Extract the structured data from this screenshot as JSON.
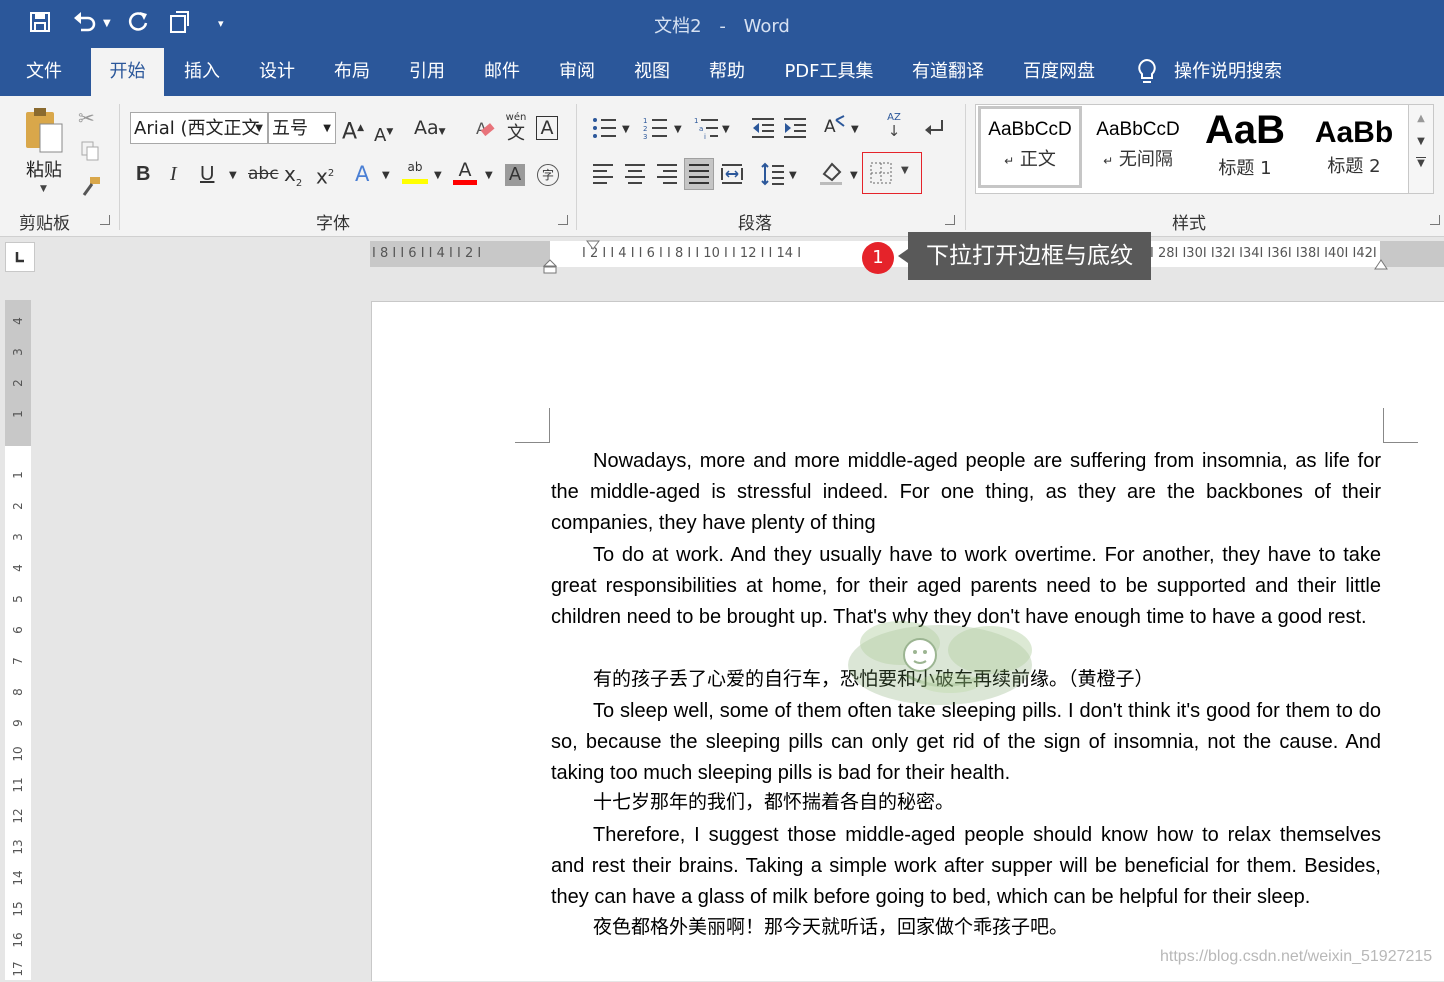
{
  "window": {
    "doc_name": "文档2",
    "dash": "-",
    "app_name": "Word"
  },
  "quick_access": {
    "customize": "▾"
  },
  "menu": {
    "tabs": [
      "文件",
      "开始",
      "插入",
      "设计",
      "布局",
      "引用",
      "邮件",
      "审阅",
      "视图",
      "帮助",
      "PDF工具集",
      "有道翻译",
      "百度网盘"
    ],
    "active_tab": "开始",
    "search": "操作说明搜索"
  },
  "ribbon": {
    "clipboard": {
      "paste": "粘贴",
      "label": "剪贴板"
    },
    "font": {
      "font_name": "Arial (西文正文",
      "font_size": "五号",
      "grow": "A",
      "shrink": "A",
      "change_case": "Aa",
      "phonetic": "wén",
      "phonetic_char": "文",
      "bold": "B",
      "italic": "I",
      "underline": "U",
      "strikethrough": "abc",
      "subscript": "x",
      "subscript_mark": "2",
      "superscript": "x",
      "superscript_mark": "2",
      "text_effects": "A",
      "highlight": "ab",
      "font_color": "A",
      "char_shading": "A",
      "enclose": "字",
      "label": "字体",
      "highlight_color": "#ffff00",
      "font_color_bar": "#ff0000"
    },
    "paragraph": {
      "label": "段落",
      "sort": "AZ"
    },
    "styles": {
      "label": "样式",
      "items": [
        {
          "sample": "AaBbCcD",
          "name": "正文",
          "mark": "↵"
        },
        {
          "sample": "AaBbCcD",
          "name": "无间隔",
          "mark": "↵"
        },
        {
          "sample": "AaB",
          "name": "标题 1",
          "mark": ""
        },
        {
          "sample": "AaBb",
          "name": "标题 2",
          "mark": ""
        }
      ]
    }
  },
  "ruler": {
    "left_labels": "I 8 I   I 6 I   I 4 I   I 2 I",
    "right_labels": "I 2 I   I 4 I   I 6 I   I 8 I   I 10 I   I 12 I   I 14 I",
    "far_labels": "I 28I  I30I  I32I  I34I  I36I  I38I  I40I  I42I",
    "vertical_top": [
      "4",
      "3",
      "2",
      "1"
    ],
    "vertical_body": [
      "1",
      "2",
      "3",
      "4",
      "5",
      "6",
      "7",
      "8",
      "9",
      "10",
      "11",
      "12",
      "13",
      "14",
      "15",
      "16",
      "17"
    ]
  },
  "callout": {
    "number": "1",
    "tooltip": "下拉打开边框与底纹"
  },
  "document": {
    "paragraphs": [
      "Nowadays, more and more middle-aged people are suffering from insomnia, as life for the middle-aged is stressful indeed. For one thing, as they are the backbones of their companies, they have plenty of thing",
      "To do at work. And they usually have to work overtime. For another, they have to take great responsibilities at home, for their aged parents need to be supported and their little children need to be brought up. That's why they don't have enough time to have a good rest.",
      "有的孩子丢了心爱的自行车，恐怕要和小破车再续前缘。（黄橙子）",
      "To sleep well, some of them often take sleeping pills. I don't think it's good for them to do so, because the sleeping pills can only get rid of the sign of insomnia, not the cause. And taking too much sleeping pills is bad for their health.",
      "十七岁那年的我们，都怀揣着各自的秘密。",
      "Therefore, I suggest those middle-aged people should know how to relax themselves and rest their brains. Taking a simple work after supper will be beneficial for them. Besides, they can have a glass of milk before going to bed, which can be helpful for their sleep.",
      "夜色都格外美丽啊！那今天就听话，回家做个乖孩子吧。"
    ]
  },
  "watermark": "https://blog.csdn.net/weixin_51927215",
  "colors": {
    "brand": "#2b579a",
    "callout": "#e5232a"
  }
}
